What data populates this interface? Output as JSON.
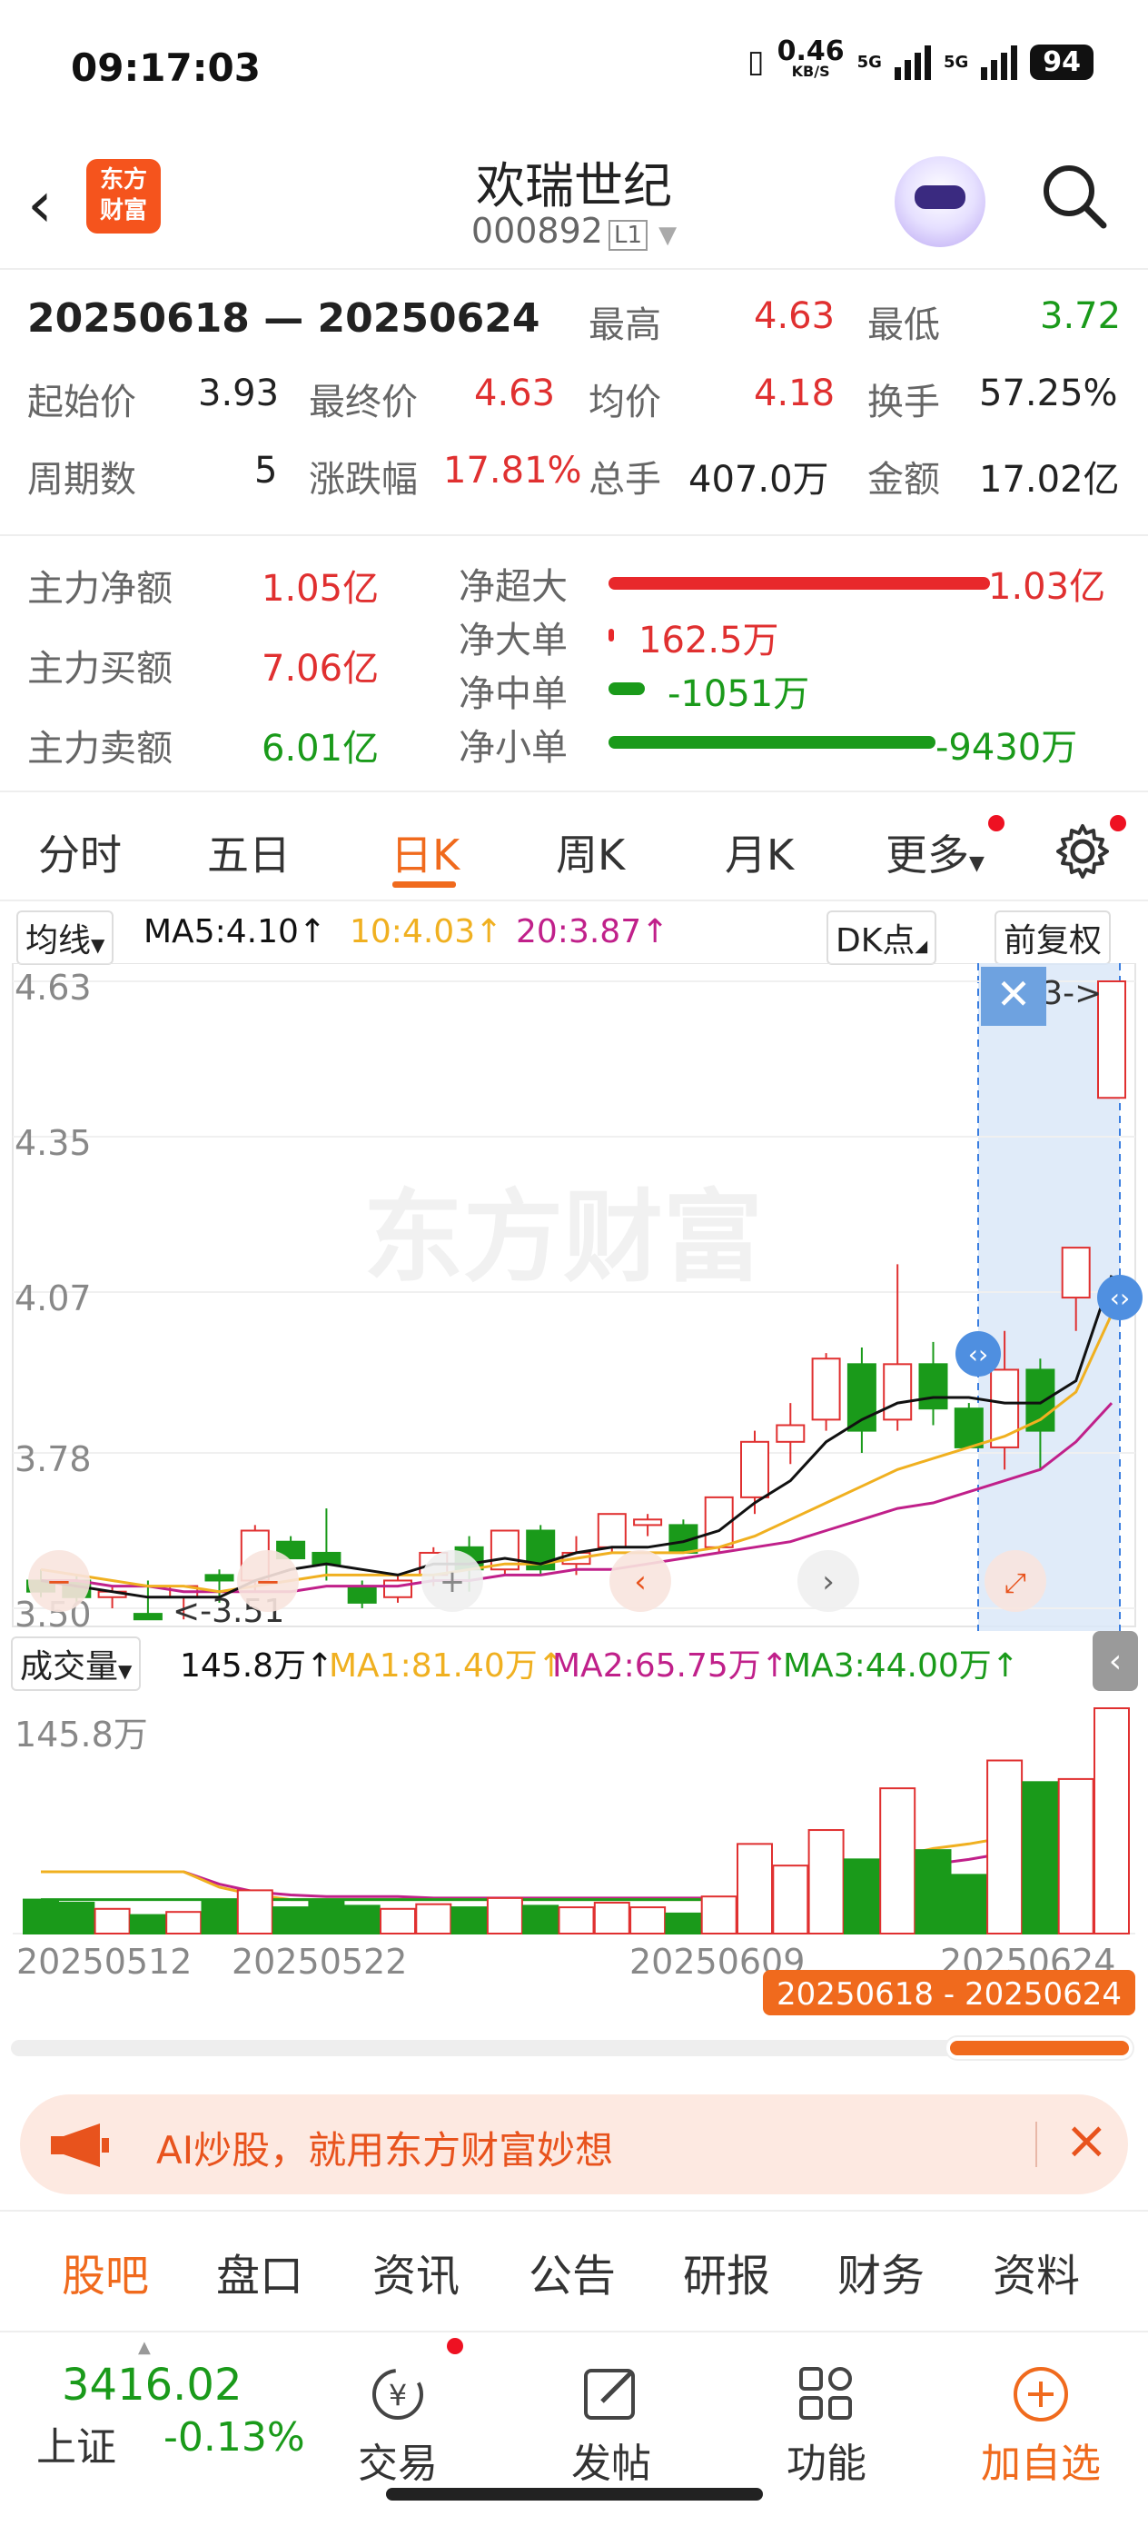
{
  "status": {
    "time": "09:17:03",
    "net_speed": "0.46",
    "net_unit": "KB/S",
    "sig1": "5G",
    "sig2": "5G",
    "battery": "94"
  },
  "header": {
    "name": "欢瑞世纪",
    "code": "000892",
    "level": "L1",
    "logo": "东方财富"
  },
  "summary": {
    "range": "20250618 — 20250624",
    "high_label": "最高",
    "high": "4.63",
    "low_label": "最低",
    "low": "3.72",
    "open_label": "起始价",
    "open": "3.93",
    "close_label": "最终价",
    "close": "4.63",
    "avg_label": "均价",
    "avg": "4.18",
    "turnover_label": "换手",
    "turnover": "57.25%",
    "periods_label": "周期数",
    "periods": "5",
    "change_label": "涨跌幅",
    "change": "17.81%",
    "volume_label": "总手",
    "volume": "407.0万",
    "amount_label": "金额",
    "amount": "17.02亿"
  },
  "fund_flow": {
    "net_label": "主力净额",
    "net": "1.05亿",
    "buy_label": "主力买额",
    "buy": "7.06亿",
    "sell_label": "主力卖额",
    "sell": "6.01亿",
    "items": [
      {
        "label": "净超大",
        "value": "1.03亿"
      },
      {
        "label": "净大单",
        "value": "162.5万"
      },
      {
        "label": "净中单",
        "value": "-1051万"
      },
      {
        "label": "净小单",
        "value": "-9430万"
      }
    ]
  },
  "tabs": [
    "分时",
    "五日",
    "日K",
    "周K",
    "月K",
    "更多"
  ],
  "ma_bar": {
    "selector": "均线",
    "ma5": "MA5:4.10↑",
    "ma10": "10:4.03↑",
    "ma20": "20:3.87↑",
    "dk": "DK点",
    "adjust": "前复权"
  },
  "vol_bar": {
    "selector": "成交量",
    "vol": "145.8万↑",
    "ma1": "MA1:81.40万↑",
    "ma2": "MA2:65.75万↑",
    "ma3": "MA3:44.00万↑"
  },
  "colors": {
    "up": "#e03030",
    "down": "#1a9a1a",
    "accent": "#f06a1d",
    "ma5": "#111111",
    "ma10": "#f0b020",
    "ma20": "#c0208a"
  },
  "chart_data": {
    "type": "candlestick",
    "y_ticks": [
      "4.63",
      "4.35",
      "4.07",
      "3.78",
      "3.50"
    ],
    "ylim": [
      3.5,
      4.63
    ],
    "max_label": "4.63->",
    "min_label": "<-3.51",
    "x_ticks": [
      "20250512",
      "20250522",
      "20250609",
      "20250624"
    ],
    "selected_range": "20250618 - 20250624",
    "vol_max_label": "145.8万",
    "candles": [
      {
        "o": 3.55,
        "h": 3.57,
        "l": 3.52,
        "c": 3.53,
        "v": 22
      },
      {
        "o": 3.55,
        "h": 3.56,
        "l": 3.51,
        "c": 3.52,
        "v": 20
      },
      {
        "o": 3.52,
        "h": 3.54,
        "l": 3.5,
        "c": 3.53,
        "v": 16
      },
      {
        "o": 3.49,
        "h": 3.55,
        "l": 3.48,
        "c": 3.48,
        "v": 12
      },
      {
        "o": 3.52,
        "h": 3.54,
        "l": 3.48,
        "c": 3.54,
        "v": 14
      },
      {
        "o": 3.56,
        "h": 3.57,
        "l": 3.51,
        "c": 3.55,
        "v": 22
      },
      {
        "o": 3.55,
        "h": 3.65,
        "l": 3.53,
        "c": 3.64,
        "v": 28
      },
      {
        "o": 3.62,
        "h": 3.63,
        "l": 3.59,
        "c": 3.59,
        "v": 17
      },
      {
        "o": 3.6,
        "h": 3.68,
        "l": 3.55,
        "c": 3.58,
        "v": 22
      },
      {
        "o": 3.54,
        "h": 3.55,
        "l": 3.5,
        "c": 3.51,
        "v": 18
      },
      {
        "o": 3.52,
        "h": 3.56,
        "l": 3.51,
        "c": 3.55,
        "v": 16
      },
      {
        "o": 3.56,
        "h": 3.61,
        "l": 3.54,
        "c": 3.6,
        "v": 19
      },
      {
        "o": 3.61,
        "h": 3.63,
        "l": 3.53,
        "c": 3.57,
        "v": 17
      },
      {
        "o": 3.57,
        "h": 3.64,
        "l": 3.56,
        "c": 3.64,
        "v": 23
      },
      {
        "o": 3.64,
        "h": 3.65,
        "l": 3.56,
        "c": 3.57,
        "v": 18
      },
      {
        "o": 3.58,
        "h": 3.63,
        "l": 3.56,
        "c": 3.6,
        "v": 17
      },
      {
        "o": 3.61,
        "h": 3.67,
        "l": 3.6,
        "c": 3.67,
        "v": 20
      },
      {
        "o": 3.65,
        "h": 3.67,
        "l": 3.63,
        "c": 3.66,
        "v": 17
      },
      {
        "o": 3.65,
        "h": 3.66,
        "l": 3.6,
        "c": 3.6,
        "v": 13
      },
      {
        "o": 3.61,
        "h": 3.7,
        "l": 3.6,
        "c": 3.7,
        "v": 24
      },
      {
        "o": 3.7,
        "h": 3.82,
        "l": 3.67,
        "c": 3.8,
        "v": 58
      },
      {
        "o": 3.8,
        "h": 3.87,
        "l": 3.76,
        "c": 3.83,
        "v": 44
      },
      {
        "o": 3.84,
        "h": 3.96,
        "l": 3.82,
        "c": 3.95,
        "v": 67
      },
      {
        "o": 3.94,
        "h": 3.97,
        "l": 3.78,
        "c": 3.82,
        "v": 48
      },
      {
        "o": 3.84,
        "h": 4.12,
        "l": 3.82,
        "c": 3.94,
        "v": 94
      },
      {
        "o": 3.94,
        "h": 3.98,
        "l": 3.83,
        "c": 3.86,
        "v": 54
      },
      {
        "o": 3.86,
        "h": 3.87,
        "l": 3.8,
        "c": 3.79,
        "v": 38
      },
      {
        "o": 3.79,
        "h": 4.0,
        "l": 3.75,
        "c": 3.93,
        "v": 112
      },
      {
        "o": 3.93,
        "h": 3.95,
        "l": 3.75,
        "c": 3.82,
        "v": 98
      },
      {
        "o": 4.06,
        "h": 4.15,
        "l": 4.0,
        "c": 4.15,
        "v": 100
      },
      {
        "o": 4.42,
        "h": 4.63,
        "l": 4.42,
        "c": 4.63,
        "v": 145.8
      }
    ],
    "ma5": [
      3.55,
      3.54,
      3.53,
      3.52,
      3.52,
      3.52,
      3.55,
      3.57,
      3.58,
      3.57,
      3.56,
      3.58,
      3.58,
      3.59,
      3.58,
      3.6,
      3.61,
      3.61,
      3.62,
      3.64,
      3.69,
      3.73,
      3.8,
      3.84,
      3.87,
      3.88,
      3.88,
      3.87,
      3.87,
      3.91,
      4.1
    ],
    "ma10": [
      3.57,
      3.56,
      3.55,
      3.54,
      3.54,
      3.53,
      3.54,
      3.55,
      3.56,
      3.56,
      3.56,
      3.56,
      3.57,
      3.58,
      3.58,
      3.59,
      3.6,
      3.6,
      3.6,
      3.61,
      3.63,
      3.66,
      3.69,
      3.72,
      3.75,
      3.77,
      3.79,
      3.81,
      3.84,
      3.89,
      4.03
    ],
    "ma20": [
      3.55,
      3.55,
      3.54,
      3.54,
      3.53,
      3.53,
      3.53,
      3.53,
      3.54,
      3.54,
      3.54,
      3.55,
      3.55,
      3.56,
      3.56,
      3.57,
      3.57,
      3.58,
      3.59,
      3.6,
      3.61,
      3.62,
      3.64,
      3.66,
      3.68,
      3.69,
      3.71,
      3.73,
      3.75,
      3.8,
      3.87
    ],
    "vol_ma1": [
      40,
      40,
      40,
      40,
      40,
      30,
      25,
      22,
      22,
      22,
      22,
      22,
      22,
      22,
      22,
      22,
      22,
      22,
      22,
      22,
      25,
      30,
      35,
      40,
      50,
      55,
      58,
      62,
      65,
      72,
      81.4
    ],
    "vol_ma2": [
      40,
      40,
      40,
      40,
      40,
      32,
      27,
      25,
      24,
      24,
      24,
      23,
      23,
      23,
      23,
      23,
      23,
      23,
      23,
      23,
      24,
      27,
      30,
      33,
      40,
      45,
      48,
      52,
      55,
      60,
      65.75
    ],
    "vol_ma3": [
      22,
      22,
      22,
      22,
      22,
      22,
      22,
      22,
      22,
      22,
      22,
      22,
      22,
      22,
      22,
      22,
      22,
      22,
      22,
      22,
      23,
      25,
      27,
      29,
      31,
      33,
      35,
      37,
      39,
      41,
      44
    ]
  },
  "ai_banner": {
    "text": "AI炒股，就用东方财富妙想"
  },
  "bottom_tabs": [
    "股吧",
    "盘口",
    "资讯",
    "公告",
    "研报",
    "财务",
    "资料"
  ],
  "footer": {
    "index_value": "3416.02",
    "index_name": "上证",
    "index_change": "-0.13%",
    "trade": "交易",
    "post": "发帖",
    "func": "功能",
    "add": "加自选"
  }
}
